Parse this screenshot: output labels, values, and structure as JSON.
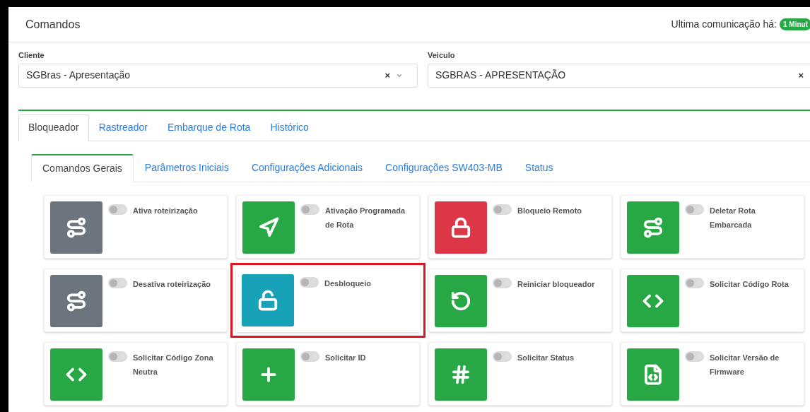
{
  "header": {
    "title": "Comandos",
    "last_comm_label": "Ultima comunicação há:",
    "last_comm_badge": "1 Minut"
  },
  "filters": [
    {
      "label": "Cliente",
      "value": "SGBras - Apresentação",
      "clear": "×",
      "has_caret": true
    },
    {
      "label": "Veiculo",
      "value": "SGBRAS - APRESENTAÇÃO",
      "clear": "×",
      "has_caret": false
    }
  ],
  "tabs": [
    {
      "label": "Bloqueador",
      "selected": true
    },
    {
      "label": "Rastreador",
      "selected": false
    },
    {
      "label": "Embarque de Rota",
      "selected": false
    },
    {
      "label": "Histórico",
      "selected": false
    }
  ],
  "subtabs": [
    {
      "label": "Comandos Gerais",
      "selected": true
    },
    {
      "label": "Parâmetros Iniciais",
      "selected": false
    },
    {
      "label": "Configurações Adicionais",
      "selected": false
    },
    {
      "label": "Configurações SW403-MB",
      "selected": false
    },
    {
      "label": "Status",
      "selected": false
    }
  ],
  "commands": [
    {
      "label": "Ativa roteirização",
      "kind": "route",
      "color": "#6c757d",
      "on": false,
      "highlighted": false
    },
    {
      "label": "Ativação Programada de Rota",
      "kind": "navigation",
      "color": "#28a745",
      "on": false,
      "highlighted": false
    },
    {
      "label": "Bloqueio Remoto",
      "kind": "lock",
      "color": "#dc3545",
      "on": false,
      "highlighted": false
    },
    {
      "label": "Deletar Rota Embarcada",
      "kind": "route",
      "color": "#28a745",
      "on": false,
      "highlighted": false
    },
    {
      "label": "Desativa roteirização",
      "kind": "route",
      "color": "#6c757d",
      "on": false,
      "highlighted": false
    },
    {
      "label": "Desbloqueio",
      "kind": "unlock",
      "color": "#17a2b8",
      "on": false,
      "highlighted": true
    },
    {
      "label": "Reiniciar bloqueador",
      "kind": "restart",
      "color": "#28a745",
      "on": false,
      "highlighted": false
    },
    {
      "label": "Solicitar Código Rota",
      "kind": "code",
      "color": "#28a745",
      "on": false,
      "highlighted": false
    },
    {
      "label": "Solicitar Código Zona Neutra",
      "kind": "code",
      "color": "#28a745",
      "on": false,
      "highlighted": false
    },
    {
      "label": "Solicitar ID",
      "kind": "plus",
      "color": "#28a745",
      "on": false,
      "highlighted": false
    },
    {
      "label": "Solicitar Status",
      "kind": "hash",
      "color": "#28a745",
      "on": false,
      "highlighted": false
    },
    {
      "label": "Solicitar Versão de Firmware",
      "kind": "file-code",
      "color": "#28a745",
      "on": false,
      "highlighted": false
    }
  ]
}
